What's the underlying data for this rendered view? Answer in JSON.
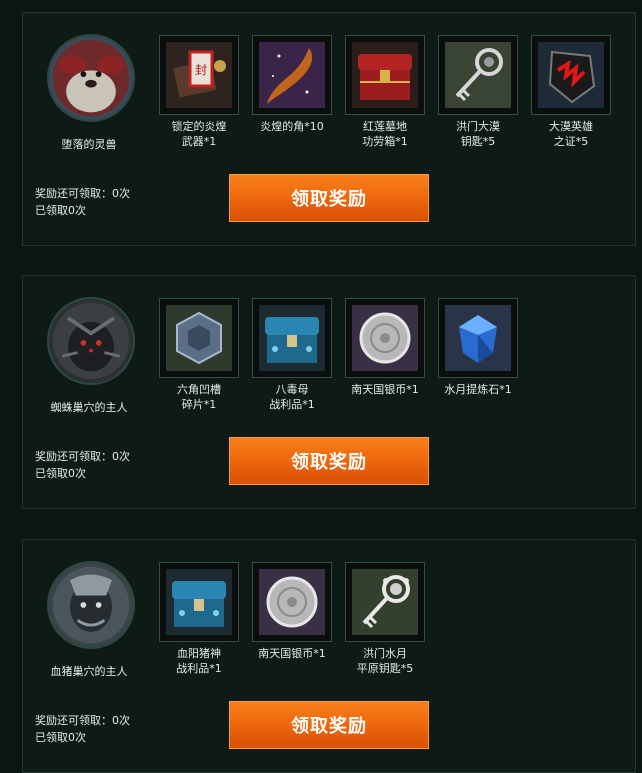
{
  "bosses": [
    {
      "name": "堕落的灵兽",
      "rewards": [
        {
          "label": "锁定的炎煌\n武器*1",
          "icon": "locked-weapon-box-icon"
        },
        {
          "label": "炎煌的角*10",
          "icon": "horn-icon"
        },
        {
          "label": "红莲墓地\n功劳箱*1",
          "icon": "red-chest-icon"
        },
        {
          "label": "洪门大漠\n钥匙*5",
          "icon": "key-icon"
        },
        {
          "label": "大漠英雄\n之证*5",
          "icon": "hero-emblem-icon"
        }
      ],
      "remaining": "奖励还可领取：0次",
      "claimed": "已领取0次",
      "button": "领取奖励"
    },
    {
      "name": "蜘蛛巢穴的主人",
      "rewards": [
        {
          "label": "六角凹槽\n碎片*1",
          "icon": "hexagon-fragment-icon"
        },
        {
          "label": "八毒母\n战利品*1",
          "icon": "blue-chest-icon"
        },
        {
          "label": "南天国银币*1",
          "icon": "silver-coin-icon"
        },
        {
          "label": "水月提炼石*1",
          "icon": "blue-gem-icon"
        }
      ],
      "remaining": "奖励还可领取：0次",
      "claimed": "已领取0次",
      "button": "领取奖励"
    },
    {
      "name": "血猪巢穴的主人",
      "rewards": [
        {
          "label": "血阳猪神\n战利品*1",
          "icon": "blue-chest-icon"
        },
        {
          "label": "南天国银币*1",
          "icon": "silver-coin-icon"
        },
        {
          "label": "洪门水月\n平原钥匙*5",
          "icon": "ornate-key-icon"
        }
      ],
      "remaining": "奖励还可领取：0次",
      "claimed": "已领取0次",
      "button": "领取奖励"
    }
  ]
}
